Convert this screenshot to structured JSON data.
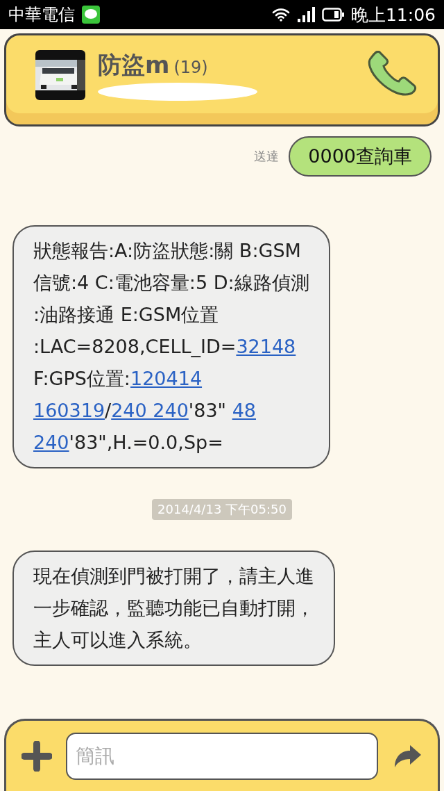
{
  "status_bar": {
    "carrier": "中華電信",
    "time": "晚上11:06"
  },
  "header": {
    "contact_name": "防盜m",
    "message_count": "(19)"
  },
  "messages": [
    {
      "kind": "sent",
      "status": "送達",
      "lines": [
        [
          {
            "text": "0000查詢車",
            "link": false
          }
        ]
      ]
    },
    {
      "kind": "received",
      "lines": [
        [
          {
            "text": "狀態報告:A:防盜狀態:關 B:GSM",
            "link": false
          }
        ],
        [
          {
            "text": "信號:4 C:電池容量:5 D:線路偵測",
            "link": false
          }
        ],
        [
          {
            "text": ":油路接通 E:GSM位置",
            "link": false
          }
        ],
        [
          {
            "text": ":LAC=8208,CELL_ID=",
            "link": false
          },
          {
            "text": "32148",
            "link": true
          }
        ],
        [
          {
            "text": "F:GPS位置:",
            "link": false
          },
          {
            "text": "120414",
            "link": true
          }
        ],
        [
          {
            "text": "160319",
            "link": true
          },
          {
            "text": "/",
            "link": false
          },
          {
            "text": "240 240",
            "link": true
          },
          {
            "text": "'83\" ",
            "link": false
          },
          {
            "text": "48",
            "link": true
          }
        ],
        [
          {
            "text": "240",
            "link": true
          },
          {
            "text": "'83\",H.=0.0,Sp=",
            "link": false
          }
        ]
      ]
    },
    {
      "kind": "date",
      "text": "2014/4/13 下午05:50"
    },
    {
      "kind": "received",
      "lines": [
        [
          {
            "text": "現在偵測到門被打開了，請主人進",
            "link": false
          }
        ],
        [
          {
            "text": "一步確認，監聽功能已自動打開，",
            "link": false
          }
        ],
        [
          {
            "text": "主人可以進入系統。",
            "link": false
          }
        ]
      ]
    }
  ],
  "composer": {
    "placeholder": "簡訊"
  }
}
